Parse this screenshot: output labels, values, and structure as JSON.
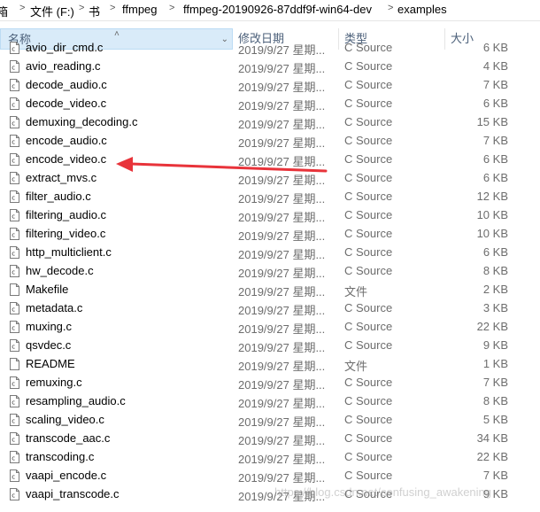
{
  "address": {
    "segments": [
      "箱",
      "文件 (F:)",
      "书",
      "ffmpeg",
      "ffmpeg-20190926-87ddf9f-win64-dev",
      "examples"
    ],
    "separator": ">"
  },
  "columns": {
    "name": "名称",
    "date": "修改日期",
    "type": "类型",
    "size": "大小"
  },
  "files": [
    {
      "name": "avio_dir_cmd.c",
      "date": "2019/9/27 星期...",
      "type": "C Source",
      "size": "6 KB",
      "icon": "c-source-file-icon"
    },
    {
      "name": "avio_reading.c",
      "date": "2019/9/27 星期...",
      "type": "C Source",
      "size": "4 KB",
      "icon": "c-source-file-icon"
    },
    {
      "name": "decode_audio.c",
      "date": "2019/9/27 星期...",
      "type": "C Source",
      "size": "7 KB",
      "icon": "c-source-file-icon"
    },
    {
      "name": "decode_video.c",
      "date": "2019/9/27 星期...",
      "type": "C Source",
      "size": "6 KB",
      "icon": "c-source-file-icon"
    },
    {
      "name": "demuxing_decoding.c",
      "date": "2019/9/27 星期...",
      "type": "C Source",
      "size": "15 KB",
      "icon": "c-source-file-icon"
    },
    {
      "name": "encode_audio.c",
      "date": "2019/9/27 星期...",
      "type": "C Source",
      "size": "7 KB",
      "icon": "c-source-file-icon"
    },
    {
      "name": "encode_video.c",
      "date": "2019/9/27 星期...",
      "type": "C Source",
      "size": "6 KB",
      "icon": "c-source-file-icon"
    },
    {
      "name": "extract_mvs.c",
      "date": "2019/9/27 星期...",
      "type": "C Source",
      "size": "6 KB",
      "icon": "c-source-file-icon"
    },
    {
      "name": "filter_audio.c",
      "date": "2019/9/27 星期...",
      "type": "C Source",
      "size": "12 KB",
      "icon": "c-source-file-icon"
    },
    {
      "name": "filtering_audio.c",
      "date": "2019/9/27 星期...",
      "type": "C Source",
      "size": "10 KB",
      "icon": "c-source-file-icon"
    },
    {
      "name": "filtering_video.c",
      "date": "2019/9/27 星期...",
      "type": "C Source",
      "size": "10 KB",
      "icon": "c-source-file-icon"
    },
    {
      "name": "http_multiclient.c",
      "date": "2019/9/27 星期...",
      "type": "C Source",
      "size": "6 KB",
      "icon": "c-source-file-icon"
    },
    {
      "name": "hw_decode.c",
      "date": "2019/9/27 星期...",
      "type": "C Source",
      "size": "8 KB",
      "icon": "c-source-file-icon"
    },
    {
      "name": "Makefile",
      "date": "2019/9/27 星期...",
      "type": "文件",
      "size": "2 KB",
      "icon": "plain-file-icon"
    },
    {
      "name": "metadata.c",
      "date": "2019/9/27 星期...",
      "type": "C Source",
      "size": "3 KB",
      "icon": "c-source-file-icon"
    },
    {
      "name": "muxing.c",
      "date": "2019/9/27 星期...",
      "type": "C Source",
      "size": "22 KB",
      "icon": "c-source-file-icon"
    },
    {
      "name": "qsvdec.c",
      "date": "2019/9/27 星期...",
      "type": "C Source",
      "size": "9 KB",
      "icon": "c-source-file-icon"
    },
    {
      "name": "README",
      "date": "2019/9/27 星期...",
      "type": "文件",
      "size": "1 KB",
      "icon": "plain-file-icon"
    },
    {
      "name": "remuxing.c",
      "date": "2019/9/27 星期...",
      "type": "C Source",
      "size": "7 KB",
      "icon": "c-source-file-icon"
    },
    {
      "name": "resampling_audio.c",
      "date": "2019/9/27 星期...",
      "type": "C Source",
      "size": "8 KB",
      "icon": "c-source-file-icon"
    },
    {
      "name": "scaling_video.c",
      "date": "2019/9/27 星期...",
      "type": "C Source",
      "size": "5 KB",
      "icon": "c-source-file-icon"
    },
    {
      "name": "transcode_aac.c",
      "date": "2019/9/27 星期...",
      "type": "C Source",
      "size": "34 KB",
      "icon": "c-source-file-icon"
    },
    {
      "name": "transcoding.c",
      "date": "2019/9/27 星期...",
      "type": "C Source",
      "size": "22 KB",
      "icon": "c-source-file-icon"
    },
    {
      "name": "vaapi_encode.c",
      "date": "2019/9/27 星期...",
      "type": "C Source",
      "size": "7 KB",
      "icon": "c-source-file-icon"
    },
    {
      "name": "vaapi_transcode.c",
      "date": "2019/9/27 星期...",
      "type": "C Source",
      "size": "9 KB",
      "icon": "c-source-file-icon"
    }
  ],
  "annotation_arrow": {
    "color": "#e8333a",
    "points_to": "encode_video.c"
  },
  "watermark": "https://blog.csdn.net/confusing_awakening"
}
